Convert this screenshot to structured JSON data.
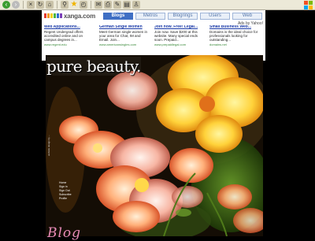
{
  "toolbar": {
    "buttons": [
      "back-icon",
      "forward-icon",
      "stop-icon",
      "refresh-icon",
      "home-icon",
      "search-icon",
      "favorites-icon",
      "history-icon",
      "mail-icon",
      "print-icon",
      "edit-icon",
      "discuss-icon",
      "messenger-icon"
    ]
  },
  "xanga_bar": {
    "logo_text": "xanga.com",
    "tabs": [
      {
        "label": "Blogs",
        "active": true
      },
      {
        "label": "Metros",
        "active": false
      },
      {
        "label": "Blogrings",
        "active": false
      },
      {
        "label": "Users",
        "active": false
      },
      {
        "label": "Web",
        "active": false
      }
    ]
  },
  "ads": {
    "ads_by": "Ads by Yahoo!",
    "items": [
      {
        "title": "Web Applications...",
        "body": "Regent Undergrad offers accredited online and on campus degrees in...",
        "url": "www.regent.edu"
      },
      {
        "title": "German Single Women",
        "body": "Meet German single women in your area for Chat, IM and Email. Join...",
        "url": "www.americansingles.com"
      },
      {
        "title": "Join now. Free! Legal...",
        "body": "Join now. Save $200 at this website. Many special ends soon. Prepaid...",
        "url": "www.prepaidlegal.com"
      },
      {
        "title": "Small Business Web...",
        "body": "Domains is the ideal choice for professionals looking for outstanding...",
        "url": "domains.net"
      }
    ]
  },
  "page": {
    "headline": "pure beauty.",
    "side_credit": "website design by ...",
    "nav_links": [
      "Home",
      "Sign in",
      "Sign Out",
      "Subscribe",
      "Profile"
    ],
    "blog_word": "Blog"
  }
}
